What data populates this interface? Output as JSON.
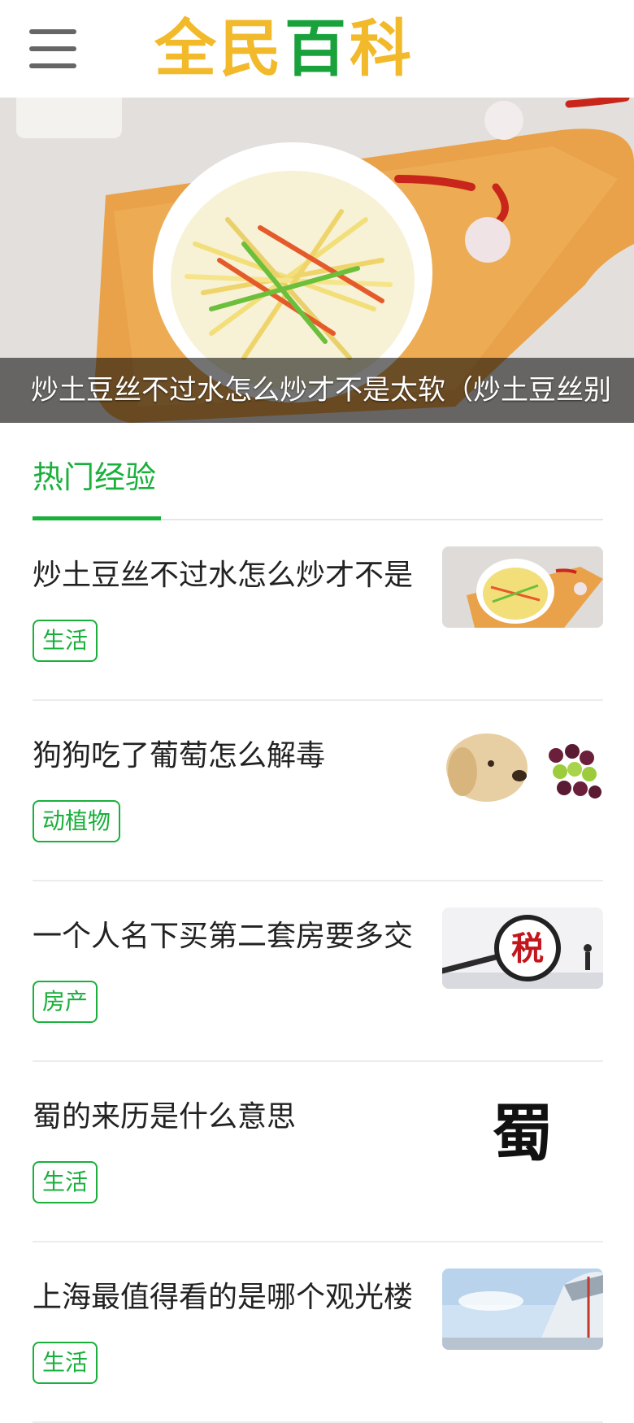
{
  "header": {
    "menu_icon": "hamburger-menu-icon",
    "logo_chars": [
      "全",
      "民",
      "百",
      "科"
    ],
    "logo_colors": [
      "#f2b92a",
      "#f2b92a",
      "#19a23b",
      "#f2b92a"
    ]
  },
  "banner": {
    "caption": "炒土豆丝不过水怎么炒才不是太软（炒土豆丝别",
    "image": "stir-fried-shredded-potatoes-photo"
  },
  "section": {
    "tab_label": "热门经验"
  },
  "colors": {
    "accent": "#1ab03c",
    "title_text": "#222222",
    "divider": "#ececec"
  },
  "items": [
    {
      "title": "炒土豆丝不过水怎么炒才不是",
      "tag": "生活",
      "thumb": "shredded-potato-dish-thumbnail"
    },
    {
      "title": "狗狗吃了葡萄怎么解毒",
      "tag": "动植物",
      "thumb": "dog-and-grapes-thumbnail"
    },
    {
      "title": "一个人名下买第二套房要多交",
      "tag": "房产",
      "thumb": "tax-magnifier-thumbnail",
      "thumb_text": "税"
    },
    {
      "title": "蜀的来历是什么意思",
      "tag": "生活",
      "thumb": "shu-character-thumbnail",
      "thumb_text": "蜀"
    },
    {
      "title": "上海最值得看的是哪个观光楼",
      "tag": "生活",
      "thumb": "shanghai-building-thumbnail"
    }
  ]
}
